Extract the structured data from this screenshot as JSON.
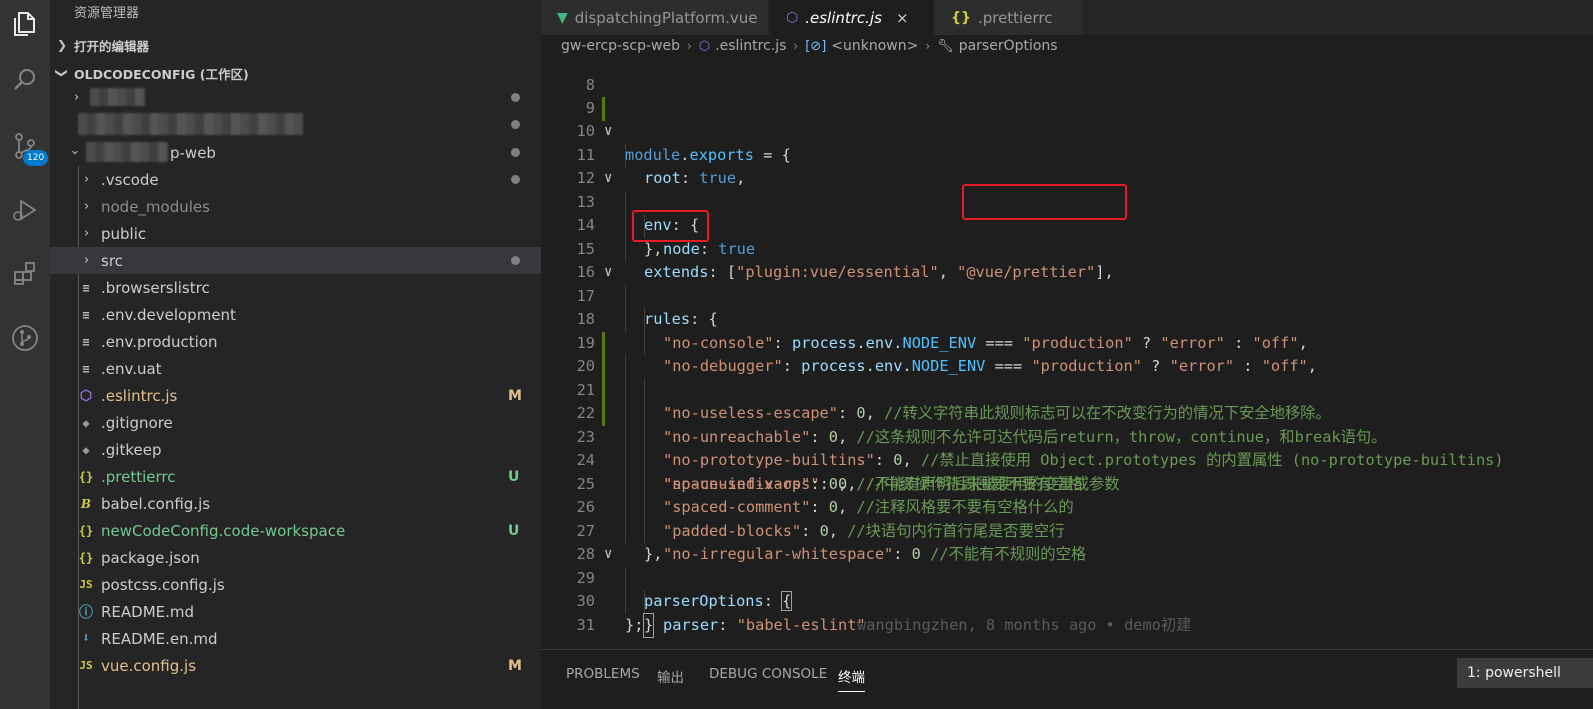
{
  "colors": {
    "accent": "#007acc",
    "highlight_box": "#e51c23",
    "modified": "#c09553",
    "untracked": "#73c991"
  },
  "sidebar": {
    "title": "资源管理器",
    "open_editors": "打开的编辑器",
    "workspace": "OLDCODECONFIG (工作区)",
    "project_suffix": "p-web",
    "files": [
      {
        "name": ".vscode",
        "icon": "chevron-right",
        "status": ""
      },
      {
        "name": "node_modules",
        "icon": "chevron-right",
        "status": ""
      },
      {
        "name": "public",
        "icon": "chevron-right",
        "status": ""
      },
      {
        "name": "src",
        "icon": "chevron-right",
        "status": ""
      },
      {
        "name": ".browserslistrc",
        "icon": "lines-icon",
        "status": ""
      },
      {
        "name": ".env.development",
        "icon": "lines-icon",
        "status": ""
      },
      {
        "name": ".env.production",
        "icon": "lines-icon",
        "status": ""
      },
      {
        "name": ".env.uat",
        "icon": "lines-icon",
        "status": ""
      },
      {
        "name": ".eslintrc.js",
        "icon": "eslint-icon",
        "status": "M"
      },
      {
        "name": ".gitignore",
        "icon": "diamond-icon",
        "status": ""
      },
      {
        "name": ".gitkeep",
        "icon": "diamond-icon",
        "status": ""
      },
      {
        "name": ".prettierrc",
        "icon": "braces-icon",
        "status": "U"
      },
      {
        "name": "babel.config.js",
        "icon": "babel-icon",
        "status": ""
      },
      {
        "name": "newCodeConfig.code-workspace",
        "icon": "braces-icon",
        "status": "U"
      },
      {
        "name": "package.json",
        "icon": "braces-icon",
        "status": ""
      },
      {
        "name": "postcss.config.js",
        "icon": "js-icon",
        "status": ""
      },
      {
        "name": "README.md",
        "icon": "info-icon",
        "status": ""
      },
      {
        "name": "README.en.md",
        "icon": "download-icon",
        "status": ""
      },
      {
        "name": "vue.config.js",
        "icon": "js-icon",
        "status": "M"
      }
    ]
  },
  "activity": {
    "scm_badge": "120"
  },
  "tabs": [
    {
      "label": "dispatchingPlatform.vue",
      "icon": "vue-icon"
    },
    {
      "label": ".eslintrc.js",
      "icon": "eslint-icon",
      "close": "×"
    },
    {
      "label": ".prettierrc",
      "icon": "braces-icon"
    }
  ],
  "breadcrumb": {
    "root": "gw-ercp-scp-web",
    "file": ".eslintrc.js",
    "scope": "<unknown>",
    "symbol": "parserOptions"
  },
  "editor": {
    "line_numbers": [
      "8",
      "9",
      "10",
      "11",
      "12",
      "13",
      "14",
      "15",
      "16",
      "17",
      "18",
      "19",
      "20",
      "21",
      "22",
      "23",
      "24",
      "25",
      "26",
      "27",
      "28",
      "29",
      "30",
      "31"
    ],
    "lines": {
      "l9a": "module",
      "l9b": ".",
      "l9c": "exports",
      "l9d": " = {",
      "l10a": "root",
      "l10b": ": ",
      "l10c": "true",
      "l10d": ",",
      "l11a": "env",
      "l11b": ": {",
      "l12a": "node",
      "l12b": ": ",
      "l12c": "true",
      "l13": "},",
      "l14a": "extends",
      "l14b": ": [",
      "l14c": "\"plugin:vue/essential\"",
      "l14d": ", ",
      "l14e": "\"@vue/prettier\"",
      "l14f": "],",
      "l15a": "rules",
      "l15b": ": {",
      "l16a": "\"no-console\"",
      "l16b": ": ",
      "l16c": "process",
      "l16d": ".",
      "l16e": "env",
      "l16f": ".",
      "l16g": "NODE_ENV",
      "l16h": " === ",
      "l16i": "\"production\"",
      "l16j": " ? ",
      "l16k": "\"error\"",
      "l16l": " : ",
      "l16m": "\"off\"",
      "l16n": ",",
      "l17a": "\"no-debugger\"",
      "l17b": ": ",
      "l17c": "process",
      "l17d": ".",
      "l17e": "env",
      "l17f": ".",
      "l17g": "NODE_ENV",
      "l17h": " === ",
      "l17i": "\"production\"",
      "l17j": " ? ",
      "l17k": "\"error\"",
      "l17l": " : ",
      "l17m": "\"off\"",
      "l17n": ",",
      "l18a": "\"no-useless-escape\"",
      "l18b": ": ",
      "l18c": "0",
      "l18d": ", ",
      "l18e": "//转义字符串此规则标志可以在不改变行为的情况下安全地移除。",
      "l19a": "\"no-unreachable\"",
      "l19b": ": ",
      "l19c": "0",
      "l19d": ", ",
      "l19e": "//这条规则不允许可达代码后return，throw，continue，和break语句。",
      "l20a": "\"no-prototype-builtins\"",
      "l20b": ": ",
      "l20c": "0",
      "l20d": ", ",
      "l20e": "//禁止直接使用 Object.prototypes 的内置属性 (no-prototype-builtins)",
      "l21a": "\"no-unused-vars\"",
      "l21b": ": ",
      "l21c": "0",
      "l21d": ", ",
      "l21e": "//不能有声明后未被使用的变量或参数",
      "l22a": "\"space-infix-ops\"",
      "l22b": ": ",
      "l22c": "0",
      "l22d": ", ",
      "l22e": "//中缀操作符周围要不要有空格",
      "l23a": "\"spaced-comment\"",
      "l23b": ": ",
      "l23c": "0",
      "l23d": ", ",
      "l23e": "//注释风格要不要有空格什么的",
      "l24a": "\"padded-blocks\"",
      "l24b": ": ",
      "l24c": "0",
      "l24d": ", ",
      "l24e": "//块语句内行首行尾是否要空行",
      "l25a": "\"no-irregular-whitespace\"",
      "l25b": ": ",
      "l25c": "0",
      "l25d": " ",
      "l25e": "//不能有不规则的空格",
      "l26": "},",
      "l27a": "parserOptions",
      "l27b": ": ",
      "l27c": "{",
      "l27d": "wangbingzhen, 8 months ago • demo初建",
      "l28a": "parser",
      "l28b": ": ",
      "l28c": "\"babel-eslint\"",
      "l29": "}",
      "l30": "};"
    }
  },
  "panel": {
    "tabs": [
      "PROBLEMS",
      "输出",
      "DEBUG CONSOLE",
      "终端"
    ],
    "terminal_select": "1: powershell"
  }
}
